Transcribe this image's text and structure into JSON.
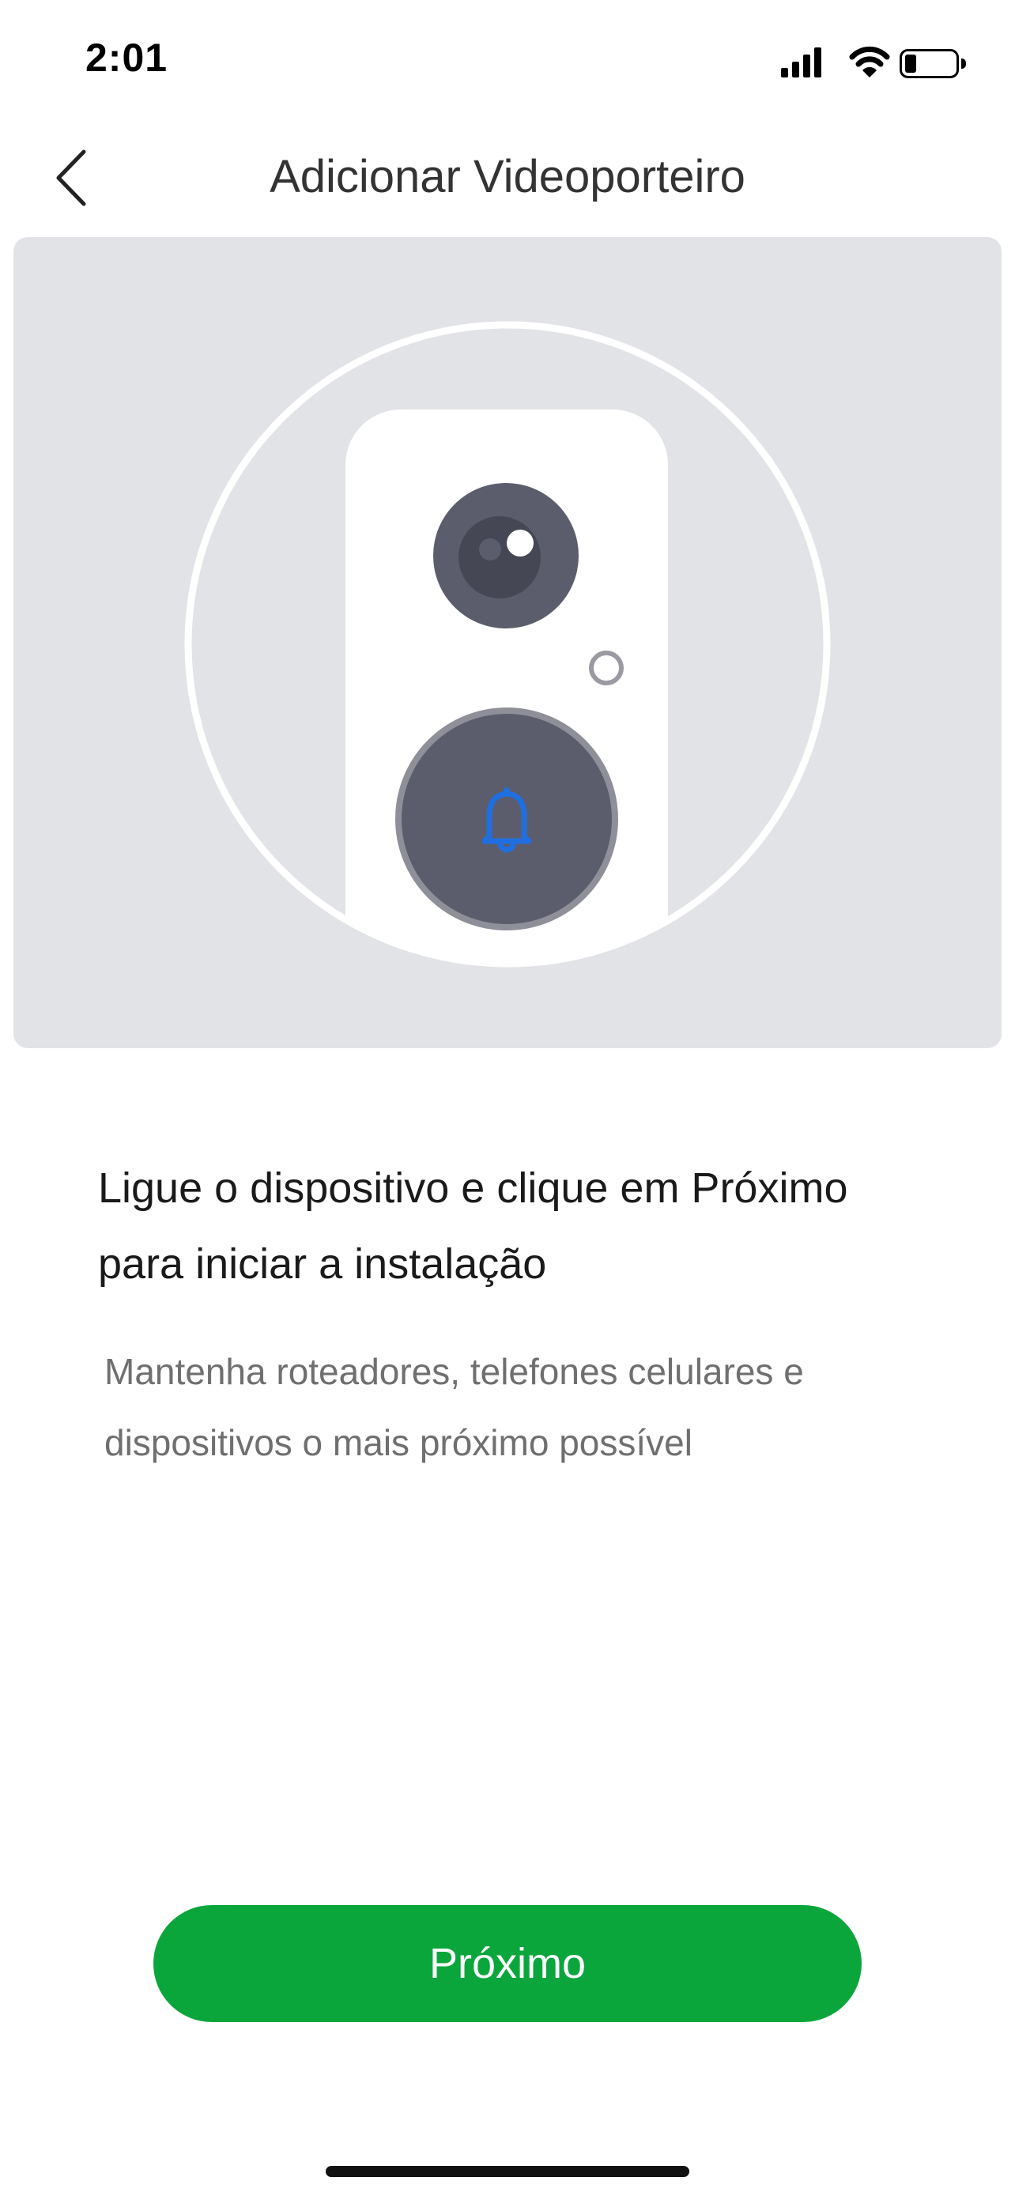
{
  "status_bar": {
    "time": "2:01"
  },
  "header": {
    "title": "Adicionar Videoporteiro"
  },
  "main": {
    "instruction": "Ligue o dispositivo e clique em Próximo para iniciar a instalação",
    "hint": "Mantenha roteadores, telefones celulares e dispositivos o mais próximo possível"
  },
  "footer": {
    "next_label": "Próximo"
  },
  "colors": {
    "primary_green": "#0aa63b",
    "illustration_bg": "#e2e3e6",
    "device_dark": "#5b5d6d",
    "bell_blue": "#1f6fe0"
  }
}
